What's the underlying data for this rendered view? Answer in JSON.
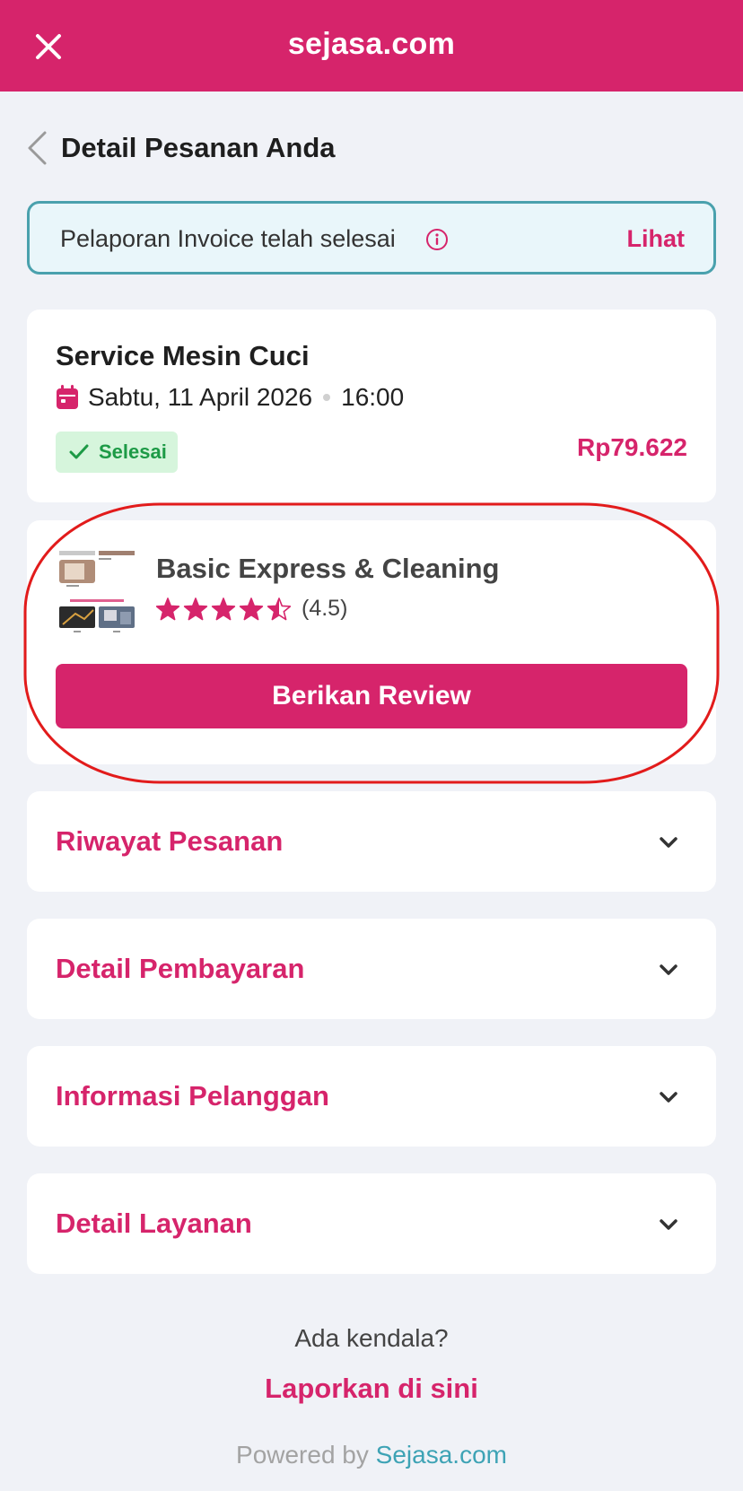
{
  "header": {
    "logo_text": "sejasa.com",
    "brand_color": "#d6246b"
  },
  "page": {
    "title": "Detail Pesanan Anda"
  },
  "banner": {
    "text": "Pelaporan Invoice telah selesai",
    "link_label": "Lihat"
  },
  "order": {
    "service_name": "Service Mesin Cuci",
    "date": "Sabtu, 11 April 2026",
    "time": "16:00",
    "status": "Selesai",
    "price": "Rp79.622"
  },
  "vendor": {
    "name": "Basic Express & Cleaning",
    "rating_value": 4.5,
    "rating_text": "(4.5)",
    "review_button": "Berikan Review"
  },
  "sections": [
    {
      "label": "Riwayat Pesanan"
    },
    {
      "label": "Detail Pembayaran"
    },
    {
      "label": "Informasi Pelanggan"
    },
    {
      "label": "Detail Layanan"
    }
  ],
  "footer": {
    "question": "Ada kendala?",
    "report_link": "Laporkan di sini",
    "powered_prefix": "Powered by",
    "powered_brand": "Sejasa.com"
  }
}
